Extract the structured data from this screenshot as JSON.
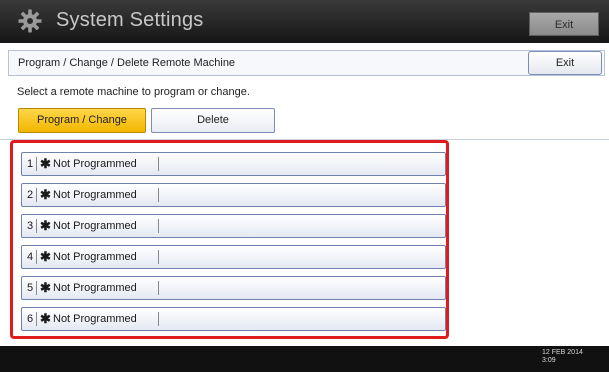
{
  "header": {
    "title": "System Settings",
    "exit_label": "Exit",
    "icon": "gear-icon"
  },
  "subheader": {
    "title": "Program / Change / Delete Remote Machine",
    "exit_label": "Exit"
  },
  "instruction": "Select a remote machine to program or change.",
  "tabs": [
    {
      "label": "Program / Change",
      "selected": true
    },
    {
      "label": "Delete",
      "selected": false
    }
  ],
  "machines": [
    {
      "number": "1",
      "mark": "✱",
      "label": "Not Programmed"
    },
    {
      "number": "2",
      "mark": "✱",
      "label": "Not Programmed"
    },
    {
      "number": "3",
      "mark": "✱",
      "label": "Not Programmed"
    },
    {
      "number": "4",
      "mark": "✱",
      "label": "Not Programmed"
    },
    {
      "number": "5",
      "mark": "✱",
      "label": "Not Programmed"
    },
    {
      "number": "6",
      "mark": "✱",
      "label": "Not Programmed"
    }
  ],
  "status": {
    "date": "12 FEB 2014",
    "time": "3:09"
  },
  "colors": {
    "highlight_frame": "#e11b1b",
    "selected_tab": "#f2b600",
    "title_bar": "#1e1e1e"
  }
}
